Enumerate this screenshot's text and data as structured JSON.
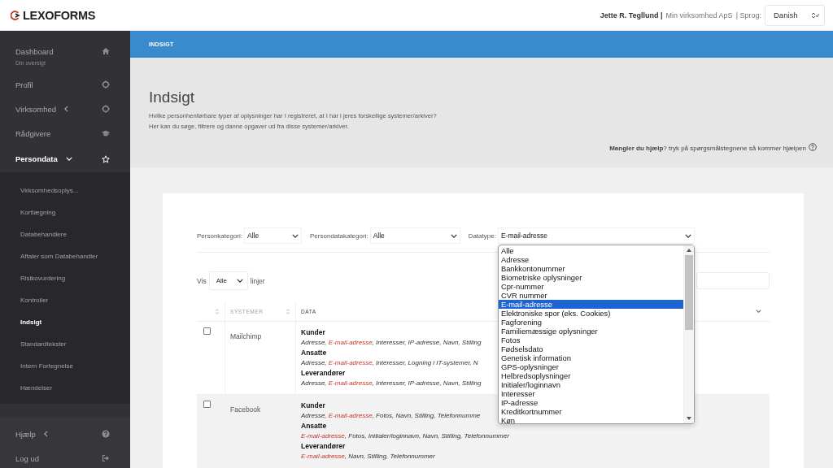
{
  "header": {
    "logo": "LEXOFORMS",
    "user_name": "Jette R. Tegllund |",
    "company": "Min virksomhed ApS",
    "language_label": "| Sprog:",
    "language": "Danish"
  },
  "sidebar": {
    "items": [
      {
        "label": "Dashboard",
        "subtitle": "Din oversigt"
      },
      {
        "label": "Profil"
      },
      {
        "label": "Virksomhed",
        "expanded": false
      },
      {
        "label": "Rådgivere"
      },
      {
        "label": "Persondata",
        "expanded": true,
        "children": [
          {
            "label": "Virksomhedsoplys...",
            "selected": false
          },
          {
            "label": "Kortlægning",
            "selected": false
          },
          {
            "label": "Databehandlere",
            "selected": false
          },
          {
            "label": "Aftaler som Databehandler",
            "selected": false
          },
          {
            "label": "Risikovurdering",
            "selected": false
          },
          {
            "label": "Kontroller",
            "selected": false
          },
          {
            "label": "Indsigt",
            "selected": true
          },
          {
            "label": "Standardtekster",
            "selected": false
          },
          {
            "label": "Intern Fortegnelse",
            "selected": false
          },
          {
            "label": "Hændelser",
            "selected": false
          }
        ]
      }
    ],
    "footer_items": [
      {
        "label": "Hjælp",
        "expanded": false
      },
      {
        "label": "Log ud"
      }
    ]
  },
  "breadcrumb": "INDSIGT",
  "page": {
    "title": "Indsigt",
    "description": [
      "Hvilke personhenførbare typer af oplysninger har I registreret, at I har i jeres forskellige systemer/arkiver?",
      "Her kan du søge, filtrere og danne opgaver ud fra disse systemer/arkiver."
    ],
    "help": "**Mangler du hjælp**? tryk på spørgsmålstegnene så kommer hjælpen"
  },
  "filters": [
    {
      "label": "Personkategori:",
      "value": "Alle"
    },
    {
      "label": "Persondatakategori:",
      "value": "Alle"
    },
    {
      "label": "Datatype:",
      "value": "E-mail-adresse",
      "expanded": true
    }
  ],
  "datatype_options": [
    {
      "label": "Alle",
      "selected": false
    },
    {
      "label": "Adresse",
      "selected": false
    },
    {
      "label": "Bankkontonummer",
      "selected": false
    },
    {
      "label": "Biometriske oplysninger",
      "selected": false
    },
    {
      "label": "Cpr-nummer",
      "selected": false
    },
    {
      "label": "CVR nummer",
      "selected": false
    },
    {
      "label": "E-mail-adresse",
      "selected": true
    },
    {
      "label": "Elektroniske spor (eks. Cookies)",
      "selected": false
    },
    {
      "label": "Fagforening",
      "selected": false
    },
    {
      "label": "Familiemæssige oplysninger",
      "selected": false
    },
    {
      "label": "Fotos",
      "selected": false
    },
    {
      "label": "Fødselsdato",
      "selected": false
    },
    {
      "label": "Genetisk information",
      "selected": false
    },
    {
      "label": "GPS-oplysninger",
      "selected": false
    },
    {
      "label": "Helbredsoplysninger",
      "selected": false
    },
    {
      "label": "Initialer/loginnavn",
      "selected": false
    },
    {
      "label": "Interesser",
      "selected": false
    },
    {
      "label": "IP-adresse",
      "selected": false
    },
    {
      "label": "Kreditkortnummer",
      "selected": false
    },
    {
      "label": "Køn",
      "selected": false
    }
  ],
  "page_size": {
    "label_before": "Vis",
    "value": "Alle",
    "label_after": "linjer"
  },
  "table": {
    "columns": [
      {
        "sortable": true
      },
      {
        "label": "SYSTEMER",
        "sortable": true
      },
      {
        "label": "DATA",
        "sortable": false
      }
    ],
    "rows": [
      {
        "checked": false,
        "system": "Mailchimp",
        "groups": [
          {
            "name": "Kunder",
            "segments": [
              {
                "text": "Adresse, ",
                "match": false
              },
              {
                "text": "E-mail-adresse",
                "match": true
              },
              {
                "text": ", Interesser, IP-adresse, Navn, Stilling",
                "match": false
              }
            ]
          },
          {
            "name": "Ansatte",
            "segments": [
              {
                "text": "Adresse, ",
                "match": false
              },
              {
                "text": "E-mail-adresse",
                "match": true
              },
              {
                "text": ", Interesser, Logning i IT-systemer, N",
                "match": false
              }
            ]
          },
          {
            "name": "Leverandører",
            "segments": [
              {
                "text": "Adresse, ",
                "match": false
              },
              {
                "text": "E-mail-adresse",
                "match": true
              },
              {
                "text": ", Interesser, IP-adresse, Navn, Stilling",
                "match": false
              }
            ]
          }
        ]
      },
      {
        "checked": false,
        "system": "Facebook",
        "groups": [
          {
            "name": "Kunder",
            "segments": [
              {
                "text": "Adresse, ",
                "match": false
              },
              {
                "text": "E-mail-adresse",
                "match": true
              },
              {
                "text": ", Fotos, Navn, Stilling, Telefonnumme",
                "match": false
              }
            ]
          },
          {
            "name": "Ansatte",
            "segments": [
              {
                "text": "E-mail-adresse",
                "match": true
              },
              {
                "text": ", Fotos, Initialer/loginnavn, Navn, Stilling, Telefonnummer",
                "match": false
              }
            ]
          },
          {
            "name": "Leverandører",
            "segments": [
              {
                "text": "E-mail-adresse",
                "match": true
              },
              {
                "text": ", Navn, Stilling, Telefonnummer",
                "match": false
              }
            ]
          }
        ]
      }
    ]
  }
}
